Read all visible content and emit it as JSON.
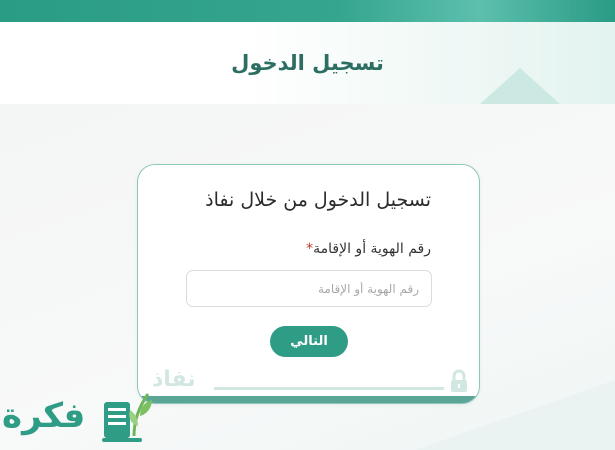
{
  "header": {
    "title": "تسجيل الدخول"
  },
  "card": {
    "title": "تسجيل الدخول من خلال نفاذ",
    "id_label": "رقم الهوية أو الإقامة",
    "required_mark": "*",
    "id_input": {
      "value": "",
      "placeholder": "رقم الهوية أو الإقامة"
    },
    "next_label": "التالي",
    "watermark_text": "نفاذ"
  },
  "logo": {
    "text": "فكرة"
  },
  "colors": {
    "primary": "#2f9c86",
    "header_text": "#2d6e62",
    "required": "#c0392b",
    "card_border": "#8cc8bc"
  },
  "icons": {
    "lock": "lock-icon",
    "logo_book": "book-leaf-icon"
  }
}
